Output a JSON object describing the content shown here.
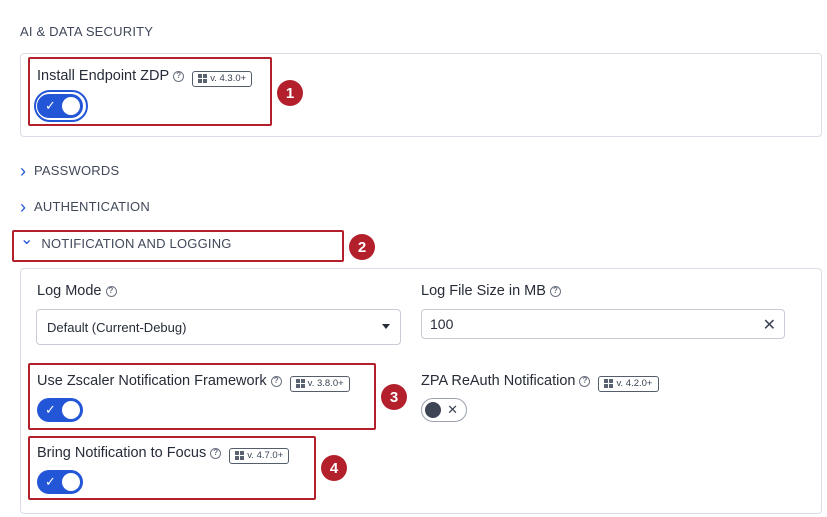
{
  "ai_section": {
    "title": "AI & DATA SECURITY",
    "install_zdp": {
      "label": "Install Endpoint ZDP",
      "version": "v. 4.3.0+",
      "enabled": true
    }
  },
  "collapsed_sections": [
    {
      "label": "PASSWORDS"
    },
    {
      "label": "AUTHENTICATION"
    }
  ],
  "notification_section": {
    "title": "NOTIFICATION AND LOGGING",
    "log_mode": {
      "label": "Log Mode",
      "value": "Default (Current-Debug)"
    },
    "log_file_size": {
      "label": "Log File Size in MB",
      "value": "100"
    },
    "zscaler_framework": {
      "label": "Use Zscaler Notification Framework",
      "version": "v. 3.8.0+",
      "enabled": true
    },
    "zpa_reauth": {
      "label": "ZPA ReAuth Notification",
      "version": "v. 4.2.0+",
      "enabled": false
    },
    "bring_focus": {
      "label": "Bring Notification to Focus",
      "version": "v. 4.7.0+",
      "enabled": true
    }
  },
  "callouts": [
    "1",
    "2",
    "3",
    "4"
  ],
  "icons": {
    "help": "?",
    "check": "✓",
    "close": "✕",
    "chevron_right": "›",
    "chevron_down": "⌄"
  },
  "colors": {
    "accent": "#2356d6",
    "callout": "#b3202b",
    "border": "#d9dde5"
  }
}
